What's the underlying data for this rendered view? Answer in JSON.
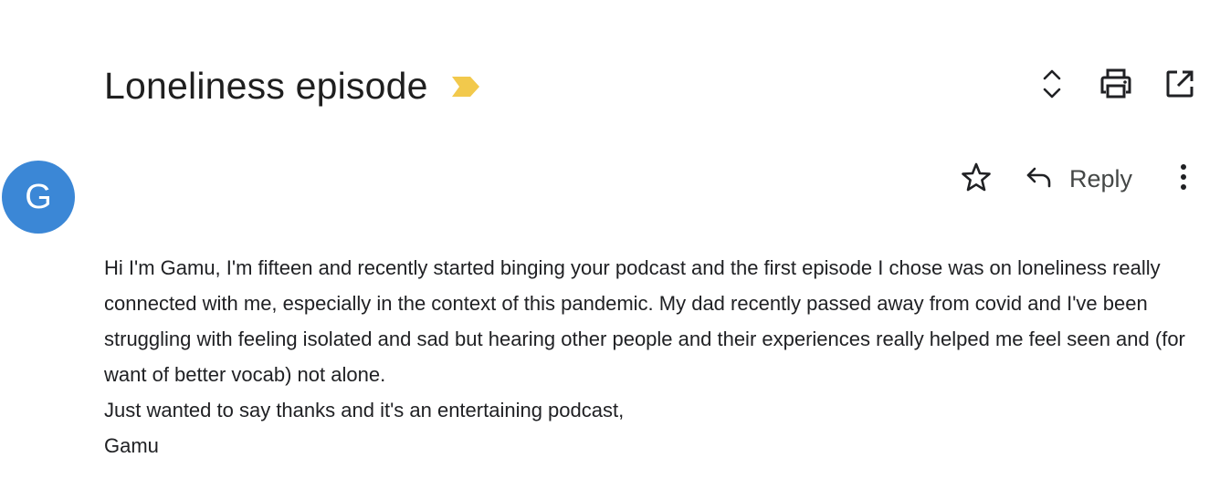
{
  "email": {
    "subject": "Loneliness episode",
    "importance_marker_color": "#f2c94c",
    "sender_initial": "G",
    "avatar_color": "#3b87d6",
    "body_paragraph": "Hi I'm Gamu, I'm fifteen and recently started binging your podcast and the first episode I chose was on loneliness really connected with me, especially in the context of this pandemic. My dad recently passed away from covid and I've been struggling with feeling isolated and sad but hearing other people and their experiences really helped me feel seen and (for want of better vocab) not alone.",
    "body_line_2": "Just wanted to say thanks and it's an entertaining podcast,",
    "signature": "Gamu"
  },
  "header_actions": {
    "icons": [
      "expand-collapse-icon",
      "print-icon",
      "open-in-new-window-icon"
    ]
  },
  "message_actions": {
    "reply_label": "Reply",
    "icons": [
      "star-icon",
      "reply-icon",
      "more-vert-icon"
    ]
  }
}
